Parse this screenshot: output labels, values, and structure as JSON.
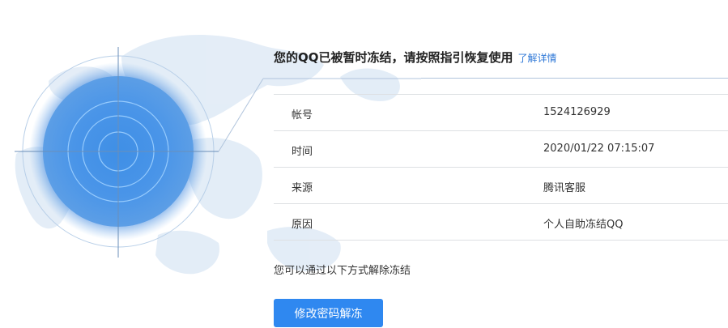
{
  "header": {
    "title": "您的QQ已被暂时冻结，请按照指引恢复使用",
    "link": "了解详情"
  },
  "info": {
    "rows": [
      {
        "label": "帐号",
        "value": "1524126929"
      },
      {
        "label": "时间",
        "value": "2020/01/22  07:15:07"
      },
      {
        "label": "来源",
        "value": "腾讯客服"
      },
      {
        "label": "原因",
        "value": "个人自助冻结QQ"
      }
    ]
  },
  "hint": "您可以通过以下方式解除冻结",
  "actions": {
    "unfreeze_label": "修改密码解冻"
  },
  "colors": {
    "accent": "#2f88f0",
    "link": "#2f78d7",
    "radar_blue": "#3a8fe0"
  },
  "icons": {
    "radar": "radar-target-icon",
    "map": "world-map-illustration"
  }
}
